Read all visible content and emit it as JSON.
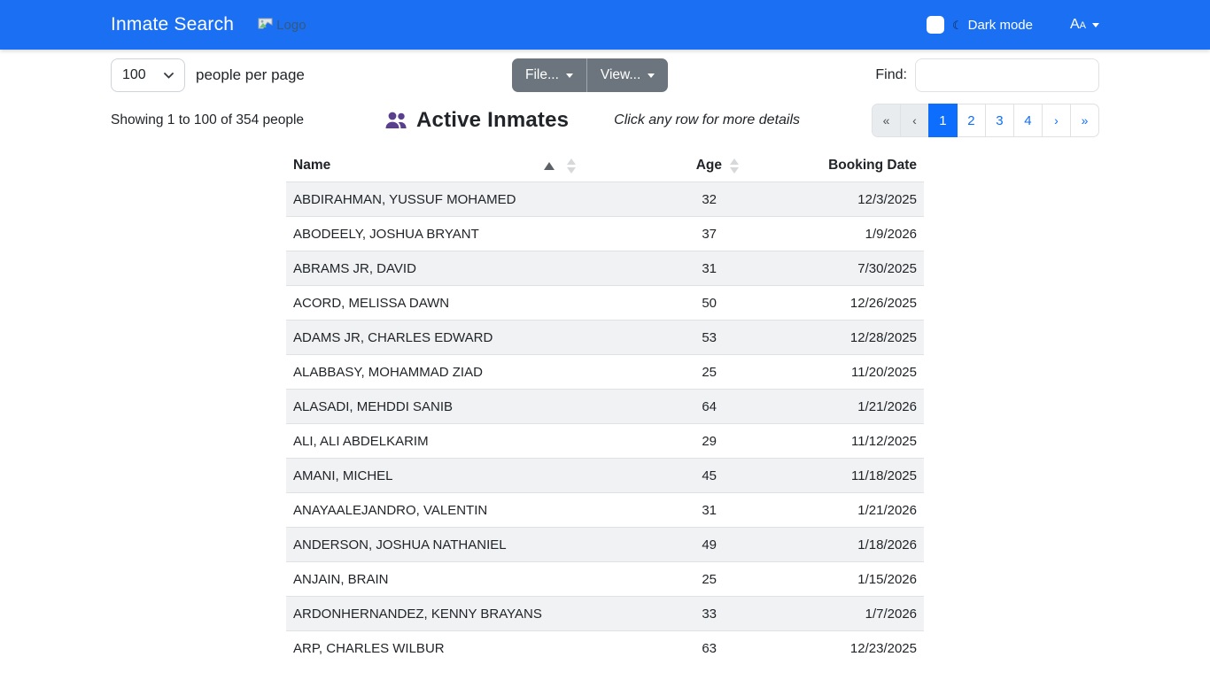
{
  "navbar": {
    "brand": "Inmate Search",
    "logo_alt": "Logo",
    "dark_mode_label": "Dark mode",
    "dark_mode_checked": false,
    "font_size_label": "Aa"
  },
  "controls": {
    "per_page_value": "100",
    "per_page_label": "people per page",
    "file_button": "File...",
    "view_button": "View...",
    "find_label": "Find:",
    "find_value": ""
  },
  "summary": {
    "showing": "Showing 1 to 100 of 354 people",
    "title": "Active Inmates",
    "hint": "Click any row for more details"
  },
  "pagination": {
    "first": "«",
    "prev": "‹",
    "pages": [
      "1",
      "2",
      "3",
      "4"
    ],
    "active_page": "1",
    "next": "›",
    "last": "»"
  },
  "table": {
    "columns": {
      "name": "Name",
      "age": "Age",
      "booking_date": "Booking Date"
    },
    "sort": {
      "column": "name",
      "direction": "ascending"
    },
    "rows": [
      {
        "name": "ABDIRAHMAN, YUSSUF MOHAMED",
        "age": "32",
        "booking_date": "12/3/2025"
      },
      {
        "name": "ABODEELY, JOSHUA BRYANT",
        "age": "37",
        "booking_date": "1/9/2026"
      },
      {
        "name": "ABRAMS JR, DAVID",
        "age": "31",
        "booking_date": "7/30/2025"
      },
      {
        "name": "ACORD, MELISSA DAWN",
        "age": "50",
        "booking_date": "12/26/2025"
      },
      {
        "name": "ADAMS JR, CHARLES EDWARD",
        "age": "53",
        "booking_date": "12/28/2025"
      },
      {
        "name": "ALABBASY, MOHAMMAD ZIAD",
        "age": "25",
        "booking_date": "11/20/2025"
      },
      {
        "name": "ALASADI, MEHDDI SANIB",
        "age": "64",
        "booking_date": "1/21/2026"
      },
      {
        "name": "ALI, ALI ABDELKARIM",
        "age": "29",
        "booking_date": "11/12/2025"
      },
      {
        "name": "AMANI, MICHEL",
        "age": "45",
        "booking_date": "11/18/2025"
      },
      {
        "name": "ANAYAALEJANDRO, VALENTIN",
        "age": "31",
        "booking_date": "1/21/2026"
      },
      {
        "name": "ANDERSON, JOSHUA NATHANIEL",
        "age": "49",
        "booking_date": "1/18/2026"
      },
      {
        "name": "ANJAIN, BRAIN",
        "age": "25",
        "booking_date": "1/15/2026"
      },
      {
        "name": "ARDONHERNANDEZ, KENNY BRAYANS",
        "age": "33",
        "booking_date": "1/7/2026"
      },
      {
        "name": "ARP, CHARLES WILBUR",
        "age": "63",
        "booking_date": "12/23/2025"
      }
    ]
  },
  "icons": {
    "logo": "broken-image-icon",
    "dark_mode": "moon-icon",
    "title": "people-icon",
    "sort_active": "triangle-up-icon",
    "sort_inactive": "diamond-sort-icon",
    "dropdown": "chevron-down-icon"
  },
  "colors": {
    "navbar_bg": "#1b6ff2",
    "link": "#0d6efd",
    "active_page_bg": "#0d6efd",
    "secondary_button_bg": "#6c757d",
    "row_stripe": "#f1f2f3",
    "people_icon": "#5b3f8f",
    "disabled_page_bg": "#e9ecef"
  }
}
